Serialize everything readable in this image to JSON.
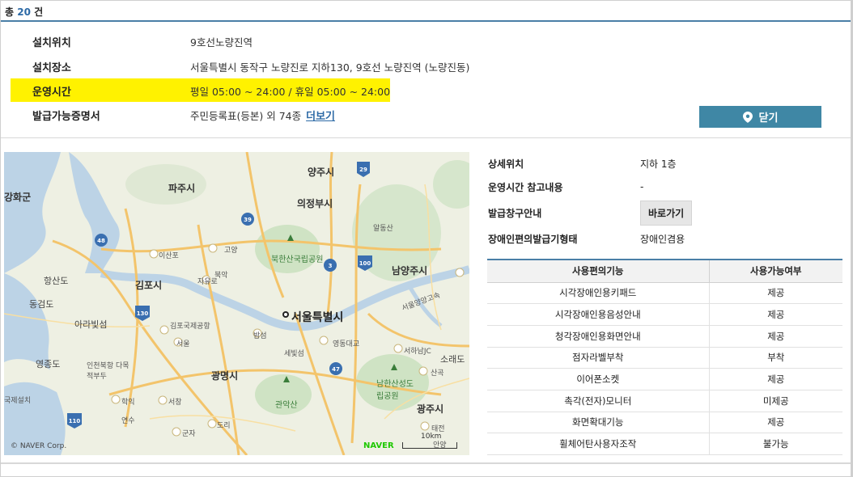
{
  "header": {
    "count_prefix": "총",
    "count": "20",
    "count_suffix": "건"
  },
  "info": {
    "rows": [
      {
        "label": "설치위치",
        "value": "9호선노량진역"
      },
      {
        "label": "설치장소",
        "value": "서울특별시 동작구 노량진로 지하130, 9호선 노량진역 (노량진동)"
      },
      {
        "label": "운영시간",
        "value": "평일 05:00 ~ 24:00 / 휴일 05:00 ~ 24:00"
      },
      {
        "label": "발급가능증명서",
        "value": "주민등록표(등본) 외 74종"
      }
    ],
    "more_link": "더보기",
    "close_label": "닫기"
  },
  "map": {
    "labels": [
      "양주시",
      "파주시",
      "의정부시",
      "강화군",
      "동두천",
      "남양주시",
      "김포시",
      "북한산국립공원",
      "서울특별시",
      "고양",
      "이산포",
      "자유로",
      "북악",
      "김포국제공항",
      "서울",
      "밤섬",
      "세빛섬",
      "광명시",
      "관악산",
      "영종도",
      "인천북항 다목적부두",
      "학익",
      "서창",
      "도리",
      "연수",
      "군자",
      "남한산성도립공원",
      "광주시",
      "산곡",
      "소래도",
      "아라빛섬",
      "동검도",
      "항산도",
      "알동산",
      "영동대교",
      "서하남JC",
      "태전",
      "안양",
      "서울양양고속",
      "국제설치"
    ],
    "copyright": "© NAVER Corp.",
    "brand": "NAVER",
    "scale": "10km"
  },
  "detail": {
    "rows": [
      {
        "label": "상세위치",
        "value": "지하 1층"
      },
      {
        "label": "운영시간 참고내용",
        "value": "-"
      },
      {
        "label": "발급창구안내",
        "button": "바로가기"
      },
      {
        "label": "장애인편의발급기형태",
        "value": "장애인겸용"
      }
    ]
  },
  "table": {
    "headers": [
      "사용편의기능",
      "사용가능여부"
    ],
    "rows": [
      [
        "시각장애인용키패드",
        "제공"
      ],
      [
        "시각장애인용음성안내",
        "제공"
      ],
      [
        "청각장애인용화면안내",
        "제공"
      ],
      [
        "점자라벨부착",
        "부착"
      ],
      [
        "이어폰소켓",
        "제공"
      ],
      [
        "촉각(전자)모니터",
        "미제공"
      ],
      [
        "화면확대기능",
        "제공"
      ],
      [
        "휠체어탄사용자조작",
        "불가능"
      ]
    ]
  },
  "colors": {
    "accent": "#3f87a5",
    "highlight": "#fff200",
    "link": "#2d6aa6"
  }
}
